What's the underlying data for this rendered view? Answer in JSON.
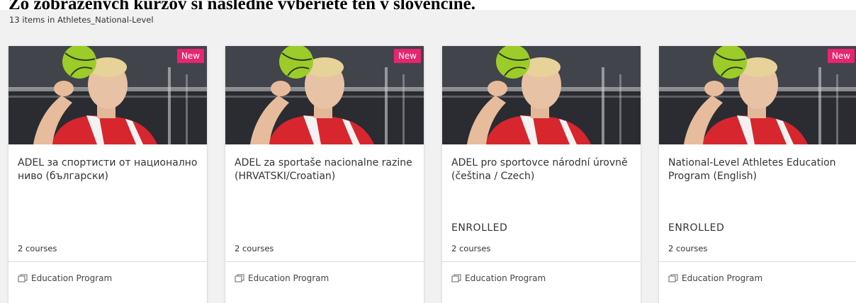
{
  "heading": "Zo zobrazených kurzov si následne vyberiete ten v slovenčine.",
  "items_count_text": "13 items in Athletes_National-Level",
  "cards": [
    {
      "badge": "New",
      "title": "ADEL за спортисти от национално ниво (български)",
      "enrolled": "",
      "courses": "2 courses",
      "type": "Education Program"
    },
    {
      "badge": "New",
      "title": "ADEL za sportaše nacionalne razine (HRVATSKI/Croatian)",
      "enrolled": "",
      "courses": "2 courses",
      "type": "Education Program"
    },
    {
      "badge": "",
      "title": "ADEL pro sportovce národní úrovně (čeština / Czech)",
      "enrolled": "ENROLLED",
      "courses": "2 courses",
      "type": "Education Program"
    },
    {
      "badge": "New",
      "title": "National-Level Athletes Education Program (English)",
      "enrolled": "ENROLLED",
      "courses": "2 courses",
      "type": "Education Program"
    }
  ],
  "colors": {
    "badge": "#e8256f",
    "jersey": "#d7262e",
    "ball": "#9ccc2a",
    "panel": "#f1f1f1"
  },
  "icons": {
    "card_type": "learning-program-icon"
  }
}
